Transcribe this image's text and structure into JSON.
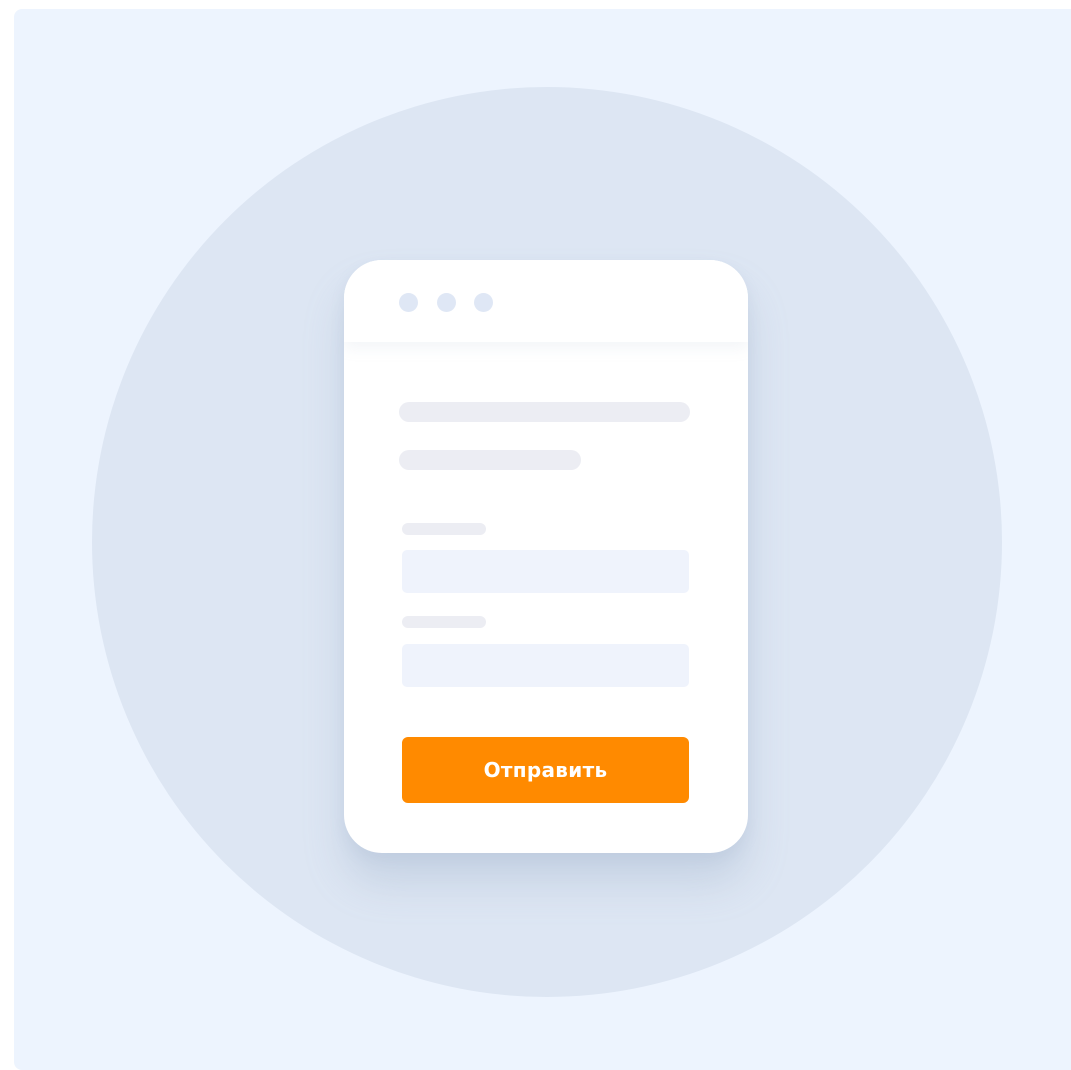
{
  "form": {
    "submit_label": "Отправить"
  },
  "colors": {
    "background": "#edf4fe",
    "circle": "#dde6f3",
    "card": "#ffffff",
    "window_dot": "#dfe7f5",
    "skeleton": "#ecedf3",
    "input_fill": "#eff3fc",
    "accent": "#ff8a00"
  }
}
